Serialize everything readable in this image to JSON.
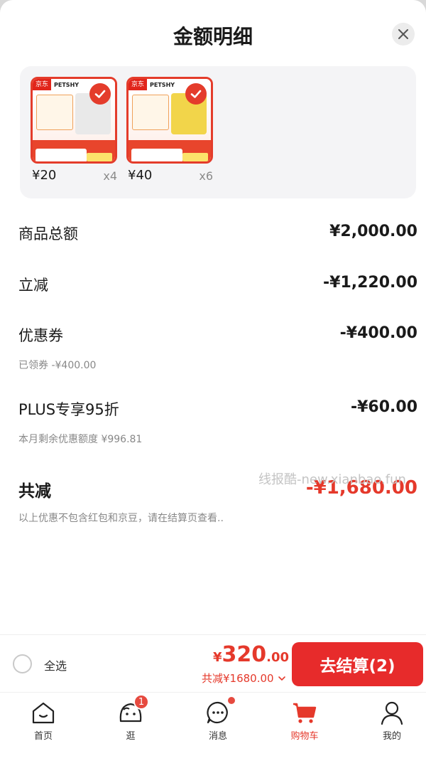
{
  "sheet": {
    "title": "金额明细"
  },
  "products": [
    {
      "brand_tag": "京东",
      "brand_name": "PETSHY",
      "price": "¥20",
      "qty": "x4",
      "selected": true
    },
    {
      "brand_tag": "京东",
      "brand_name": "PETSHY",
      "price": "¥40",
      "qty": "x6",
      "selected": true
    }
  ],
  "breakdown": {
    "subtotal": {
      "label": "商品总额",
      "amount": "¥2,000.00"
    },
    "instant_discount": {
      "label": "立减",
      "amount": "-¥1,220.00"
    },
    "coupon": {
      "label": "优惠券",
      "amount": "-¥400.00",
      "note": "已领券 -¥400.00"
    },
    "plus": {
      "label": "PLUS专享95折",
      "amount": "-¥60.00",
      "note": "本月剩余优惠额度 ¥996.81"
    },
    "total_discount": {
      "label": "共减",
      "amount": "-¥1,680.00",
      "note": "以上优惠不包含红包和京豆，请在结算页查看.."
    }
  },
  "watermark": "线报酷-new.xianbao.fun",
  "cart_bar": {
    "select_all": "全选",
    "price_currency": "¥",
    "price_int": "320",
    "price_dec": ".00",
    "total_cut": "共减¥1680.00",
    "checkout": "去结算(2)"
  },
  "tabbar": [
    {
      "label": "首页",
      "icon": "home-icon"
    },
    {
      "label": "逛",
      "icon": "explore-face-icon",
      "badge": "1"
    },
    {
      "label": "消息",
      "icon": "message-icon"
    },
    {
      "label": "购物车",
      "icon": "cart-icon",
      "active": true
    },
    {
      "label": "我的",
      "icon": "profile-icon"
    }
  ],
  "colors": {
    "accent_red": "#e5392b",
    "checkout_red": "#e72b2b"
  }
}
